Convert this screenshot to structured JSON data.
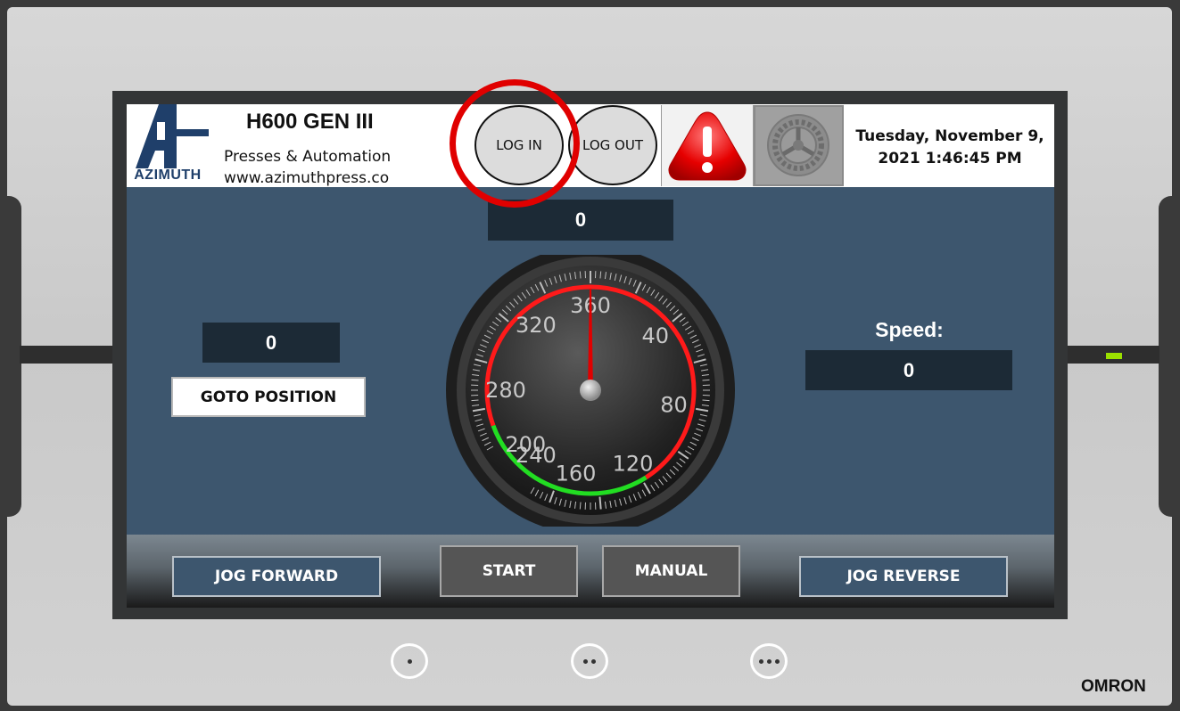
{
  "header": {
    "logo_text": "AZIMUTH",
    "title": "H600 GEN III",
    "subtitle": "Presses & Automation",
    "website": "www.azimuthpress.co",
    "login_label": "LOG IN",
    "logout_label": "LOG OUT",
    "date_line1": "Tuesday, November 9,",
    "date_line2": "2021 1:46:45 PM"
  },
  "main": {
    "top_readout": "0",
    "position_readout": "0",
    "goto_label": "GOTO POSITION",
    "speed_label": "Speed:",
    "speed_readout": "0"
  },
  "gauge": {
    "ticks": [
      "360",
      "40",
      "80",
      "120",
      "160",
      "200",
      "240",
      "280",
      "320"
    ],
    "value": 0
  },
  "footer": {
    "jog_forward": "JOG FORWARD",
    "start": "START",
    "manual": "MANUAL",
    "jog_reverse": "JOG REVERSE"
  },
  "device": {
    "brand": "OMRON"
  },
  "colors": {
    "screen_bg": "#3d566e",
    "display_bg": "#1c2a36",
    "highlight_ring": "#e00000",
    "gauge_red": "#ff1a1a",
    "gauge_green": "#22dd22",
    "led": "#9be000"
  }
}
